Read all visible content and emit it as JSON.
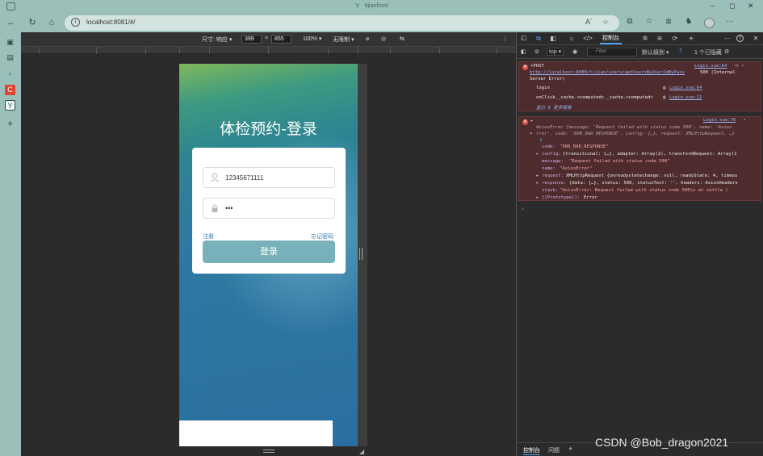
{
  "window": {
    "title": "tijianfront",
    "logo_glyph": "Y",
    "minimize": "–",
    "maximize": "◻",
    "close": "✕"
  },
  "address_bar": {
    "url": "localhost:8081/#/",
    "info_glyph": "i",
    "read_aloud_glyph": "A´",
    "favorite_glyph": "☆"
  },
  "nav": {
    "back": "←",
    "reload": "↻",
    "home": "⌂"
  },
  "toolbar_icons": {
    "split": "⧉",
    "favorites": "☆",
    "collections": "⧈",
    "extensions": "♞",
    "more": "···"
  },
  "sidebar": {
    "icons": [
      "▣",
      "▤",
      "⌕",
      "C",
      "Y",
      "+"
    ]
  },
  "device_toolbar": {
    "size_label": "尺寸: 响应 ▾",
    "width": "399",
    "times": "×",
    "height": "855",
    "zoom": "100% ▾",
    "throttle": "无限制 ▾",
    "icon_a": "⌀",
    "icon_b": "◎",
    "icon_c": "⇆",
    "more": "⋮"
  },
  "login": {
    "title": "体检预约-登录",
    "username_value": "12345671111",
    "password_value": "•••",
    "user_icon": "⍝",
    "lock_icon": "🔒",
    "register_link": "注册",
    "forgot_link": "忘记密码",
    "login_button": "登录"
  },
  "devtools": {
    "active_tab": "控制台",
    "tab_icons": [
      "⧠",
      "⧉",
      "◧",
      "⌂",
      "</>",
      "",
      "✲",
      "≋",
      "⟳",
      "+"
    ],
    "header_right": [
      "···",
      "?",
      "✕"
    ],
    "filter_bar": {
      "top_context": "top ▾",
      "filter_placeholder": "Filter",
      "levels": "默认级别 ▾",
      "issues_count": "7",
      "hidden": "1 个已隐藏"
    },
    "error1": {
      "method": "▾POST",
      "source": "Login.vue:64",
      "url": "http://localhost:8080/tijian/users/getUsersByUserIdByPass",
      "status": "500 (Internal",
      "status2": "Server Error)",
      "frame1_name": "login",
      "frame1_at": "@",
      "frame1_src": "Login.vue:64",
      "frame2_name": "onClick._cache.<computed>._cache.<computed>",
      "frame2_at": "@",
      "frame2_src": "Login.vue:21",
      "more": "显示 9 更多框架"
    },
    "error2": {
      "source": "Login.vue:76",
      "line1": "AxiosError {message: 'Request failed with status code 500', name: 'Axios",
      "line2": "rror', code: 'ERR_BAD_RESPONSE', config: {…}, request: XMLHttpRequest, …}",
      "code_key": "code:",
      "code_val": "\"ERR_BAD_RESPONSE\"",
      "config_key": "config:",
      "config_val": "{transitional: {…}, adapter: Array(2), transformRequest: Array(1",
      "message_key": "message:",
      "message_val": "\"Request failed with status code 500\"",
      "name_key": "name:",
      "name_val": "\"AxiosError\"",
      "request_key": "request:",
      "request_val": "XMLHttpRequest {onreadystatechange: null, readyState: 4, timeou",
      "response_key": "response:",
      "response_val": "{data: {…}, status: 500, statusText: '', headers: AxiosHeaders",
      "stack_key": "stack:",
      "stack_val": "\"AxiosError: Request failed with status code 500\\n    at settle (",
      "proto_key": "[[Prototype]]:",
      "proto_val": "Error"
    },
    "prompt": "›",
    "bottom_tabs": [
      "控制台",
      "问题",
      "+"
    ]
  },
  "watermark": "CSDN @Bob_dragon2021"
}
